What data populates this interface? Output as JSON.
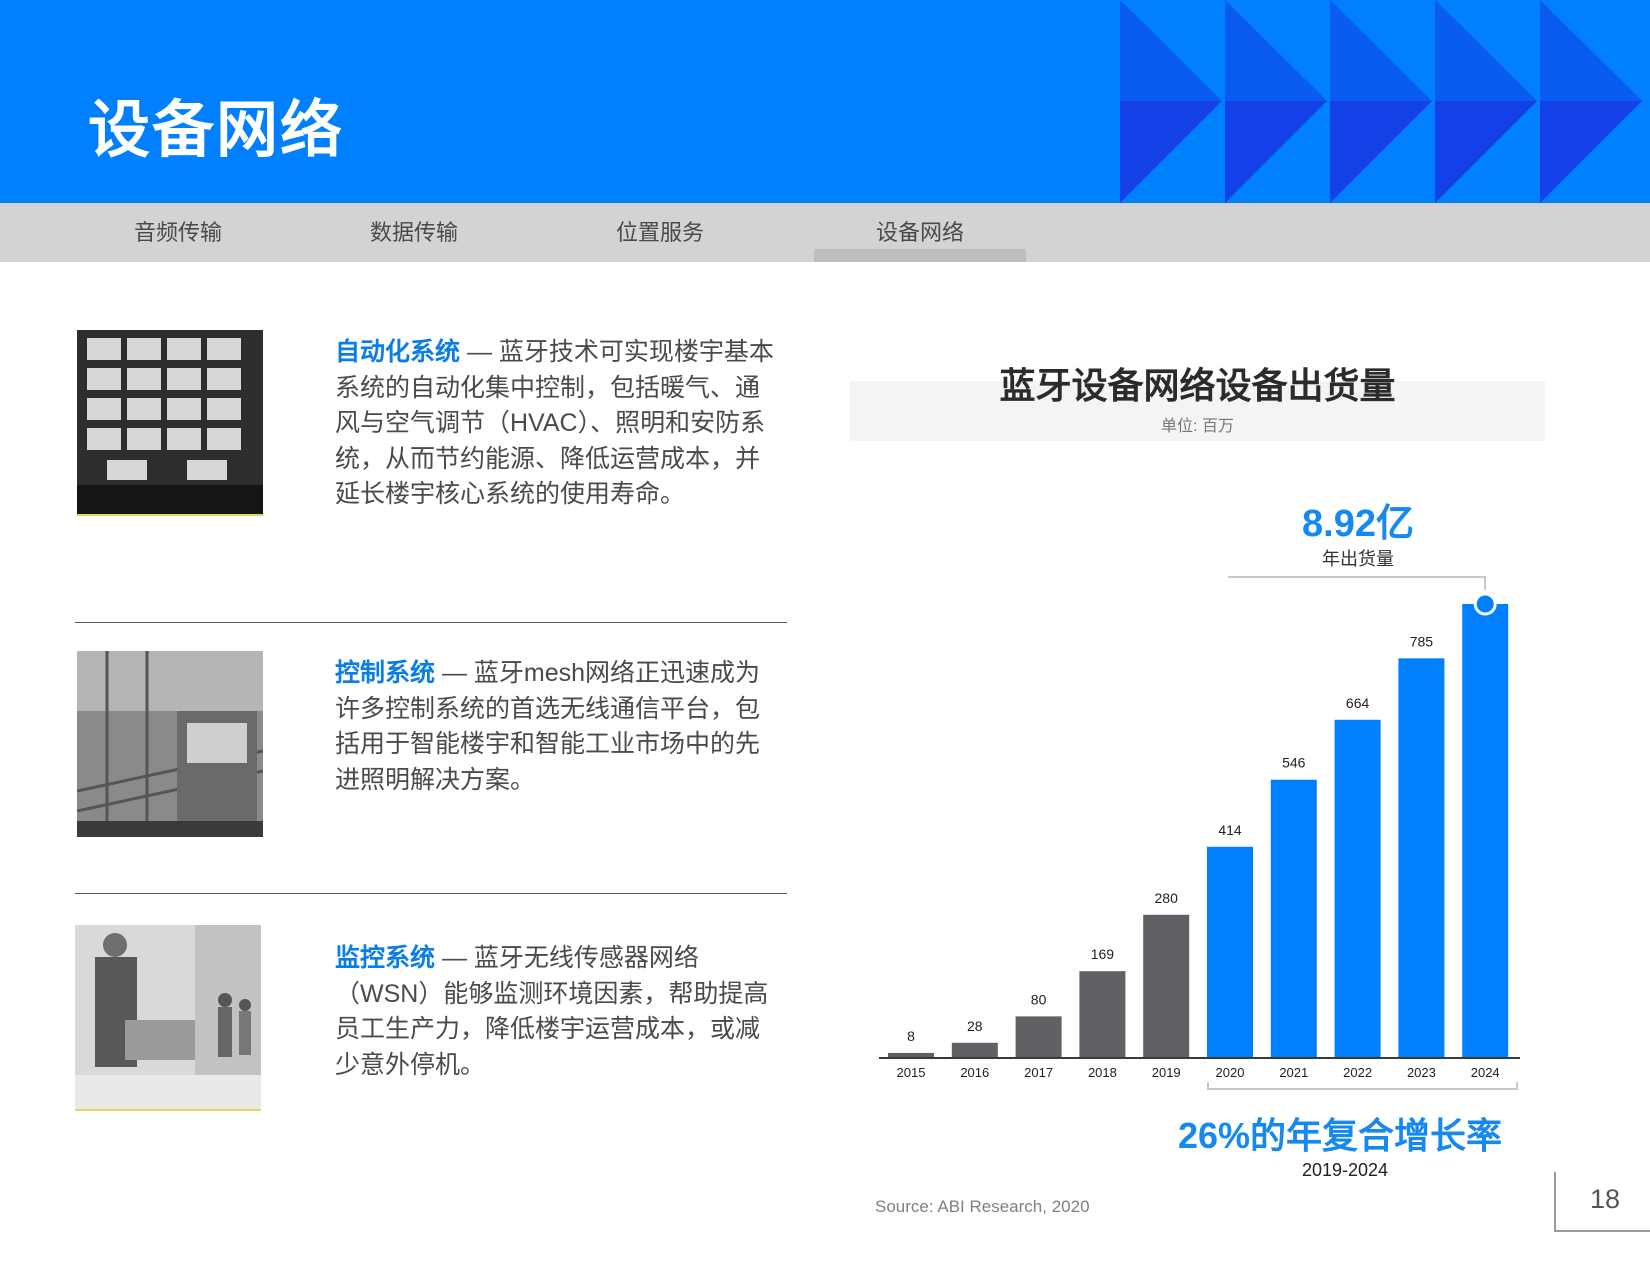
{
  "header": {
    "title": "设备网络"
  },
  "nav": {
    "tabs": [
      "音频传输",
      "数据传输",
      "位置服务",
      "设备网络"
    ],
    "active": "设备网络"
  },
  "sections": [
    {
      "lead": "自动化系统",
      "text": " — 蓝牙技术可实现楼宇基本系统的自动化集中控制，包括暖气、通风与空气调节（HVAC）、照明和安防系统，从而节约能源、降低运营成本，并延长楼宇核心系统的使用寿命。"
    },
    {
      "lead": "控制系统",
      "text": " — 蓝牙mesh网络正迅速成为许多控制系统的首选无线通信平台，包括用于智能楼宇和智能工业市场中的先进照明解决方案。"
    },
    {
      "lead": "监控系统",
      "text": " — 蓝牙无线传感器网络（WSN）能够监测环境因素，帮助提高员工生产力，降低楼宇运营成本，或减少意外停机。"
    }
  ],
  "chart_data": {
    "type": "bar",
    "title": "蓝牙设备网络设备出货量",
    "unit": "单位: 百万",
    "categories": [
      "2015",
      "2016",
      "2017",
      "2018",
      "2019",
      "2020",
      "2021",
      "2022",
      "2023",
      "2024"
    ],
    "values": [
      8,
      28,
      80,
      169,
      280,
      414,
      546,
      664,
      785,
      892
    ],
    "data_labels": [
      "8",
      "28",
      "80",
      "169",
      "280",
      "414",
      "546",
      "664",
      "785",
      ""
    ],
    "colors": {
      "historical": "#616165",
      "forecast": "#0080ff",
      "accent": "#1689f0"
    },
    "forecast_start": "2020",
    "highlight": {
      "value": "8.92亿",
      "label": "年出货量"
    },
    "cagr": {
      "value": "26%的年复合增长率",
      "period": "2019-2024"
    }
  },
  "source": "Source: ABI Research, 2020",
  "page_number": "18"
}
